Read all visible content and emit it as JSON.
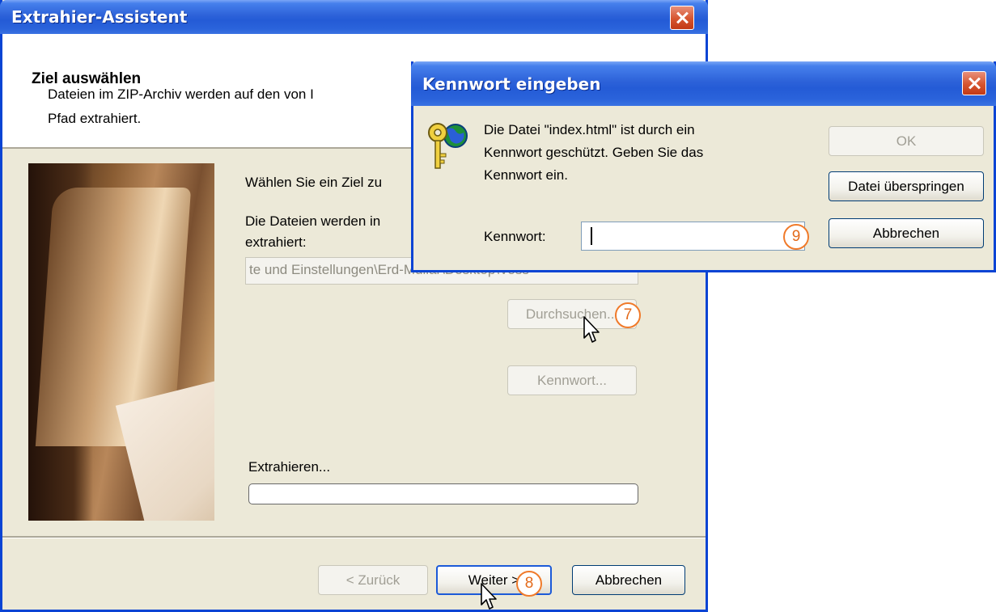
{
  "wizard": {
    "title": "Extrahier-Assistent",
    "heading": "Ziel auswählen",
    "description_line1": "Dateien im ZIP-Archiv werden auf den von I",
    "description_line2": "Pfad extrahiert.",
    "choose_target": "Wählen Sie ein Ziel zu",
    "files_line1": "Die Dateien werden in",
    "files_line2": "extrahiert:",
    "path_value": "te und Einstellungen\\Erd-Mullar\\Desktop\\Voss",
    "browse_label": "Durchsuchen...",
    "password_label": "Kennwort...",
    "extracting_label": "Extrahieren...",
    "progress": 0,
    "back_label": "< Zurück",
    "next_label": "Weiter >",
    "cancel_label": "Abbrechen"
  },
  "dialog": {
    "title": "Kennwort eingeben",
    "message_line1": "Die Datei \"index.html\" ist durch ein",
    "message_line2": "Kennwort geschützt. Geben Sie das",
    "message_line3": "Kennwort ein.",
    "password_field_label": "Kennwort:",
    "password_value": "",
    "ok_label": "OK",
    "skip_label": "Datei überspringen",
    "cancel_label": "Abbrechen"
  },
  "annotations": [
    "7",
    "8",
    "9"
  ],
  "colors": {
    "titlebar": "#245bd6",
    "window_bg": "#ece9d8",
    "badge": "#f07a2a",
    "close": "#d6542f"
  }
}
